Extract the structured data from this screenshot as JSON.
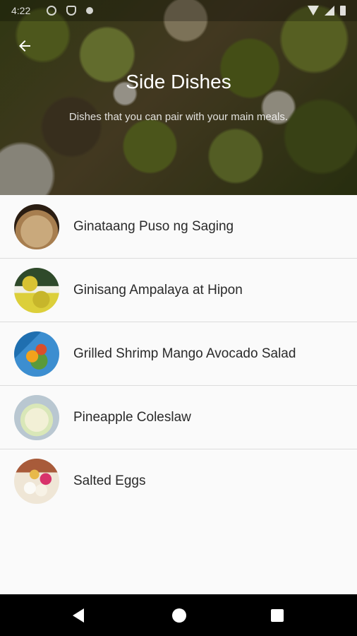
{
  "status_bar": {
    "time": "4:22",
    "icons": [
      "settings-icon",
      "shield-icon",
      "dot-icon",
      "wifi-icon",
      "signal-icon",
      "battery-icon"
    ]
  },
  "header": {
    "back_icon": "arrow-left-icon",
    "title": "Side Dishes",
    "subtitle": "Dishes that you can pair with your main meals."
  },
  "dishes": [
    {
      "label": "Ginataang Puso ng Saging"
    },
    {
      "label": "Ginisang Ampalaya at Hipon"
    },
    {
      "label": "Grilled Shrimp Mango Avocado Salad"
    },
    {
      "label": "Pineapple Coleslaw"
    },
    {
      "label": "Salted Eggs"
    }
  ],
  "nav_bar": {
    "icons": [
      "back-triangle-icon",
      "home-circle-icon",
      "recents-square-icon"
    ]
  },
  "colors": {
    "list_background": "#fafafa",
    "divider": "#dcdcdc",
    "text": "#2a2a2a",
    "nav_background": "#000000"
  }
}
